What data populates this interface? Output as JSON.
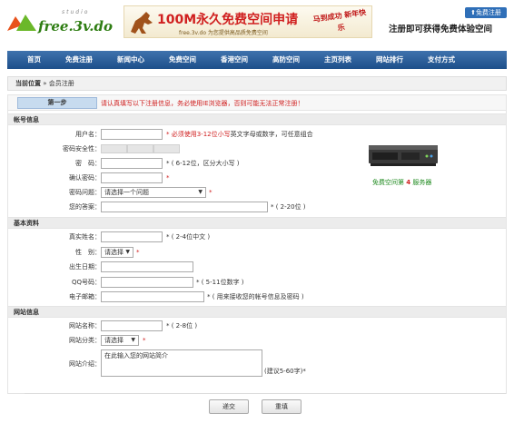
{
  "header": {
    "logo_text": "free.3v.do",
    "logo_sub": "studio",
    "banner_title": "100M永久免费空间申请",
    "banner_sub": "free.3v.do 为您提供高品质免费空间",
    "banner_newyear": "马到成功 新年快乐",
    "register_tag": "免费注册",
    "slogan": "注册即可获得免费体验空间"
  },
  "nav": {
    "items": [
      "首页",
      "免费注册",
      "新闻中心",
      "免费空间",
      "香港空间",
      "高防空间",
      "主页列表",
      "网站排行",
      "支付方式"
    ]
  },
  "breadcrumb": {
    "current": "当前位置",
    "sep": "»",
    "page": "会员注册"
  },
  "step": {
    "label": "第一步",
    "notice": "请认真填写以下注册信息，务必使用IE浏览器，否则可能无法正常注册！"
  },
  "sections": {
    "account": "帐号信息",
    "basic": "基本资料",
    "site": "网站信息"
  },
  "fields": {
    "username": {
      "label": "用户名：",
      "hint_a": "* 必须使用3-12位",
      "hint_red": "小写",
      "hint_b": "英文字母或数字，可任意组合"
    },
    "strength": {
      "label": "密码安全性："
    },
    "password": {
      "label": "密　码：",
      "hint": "* ( 6-12位，区分大小写 )"
    },
    "confirm": {
      "label": "确认密码：",
      "hint": "*"
    },
    "question": {
      "label": "密码问题：",
      "value": "请选择一个问题",
      "hint": "*"
    },
    "answer": {
      "label": "您的答案：",
      "hint": "* ( 2-20位 )"
    },
    "realname": {
      "label": "真实姓名：",
      "hint": "* ( 2-4位中文 )"
    },
    "gender": {
      "label": "性　别：",
      "value": "请选择",
      "hint": "*"
    },
    "birth": {
      "label": "出生日期："
    },
    "qq": {
      "label": "QQ号码：",
      "hint": "* ( 5-11位数字 )"
    },
    "email": {
      "label": "电子邮箱：",
      "hint": "* ( 用来接收您的帐号信息及密码 )"
    },
    "sitename": {
      "label": "网站名称：",
      "hint": "* ( 2-8位 )"
    },
    "sitecat": {
      "label": "网站分类：",
      "value": "请选择",
      "hint": "*"
    },
    "siteintro": {
      "label": "网站介绍：",
      "value": "在此输入您的网站简介",
      "hint": "(建议5-60字)*"
    }
  },
  "server_caption": {
    "a": "免费空间第",
    "num": "4",
    "b": "服务器"
  },
  "buttons": {
    "submit": "递交",
    "reset": "重填"
  }
}
